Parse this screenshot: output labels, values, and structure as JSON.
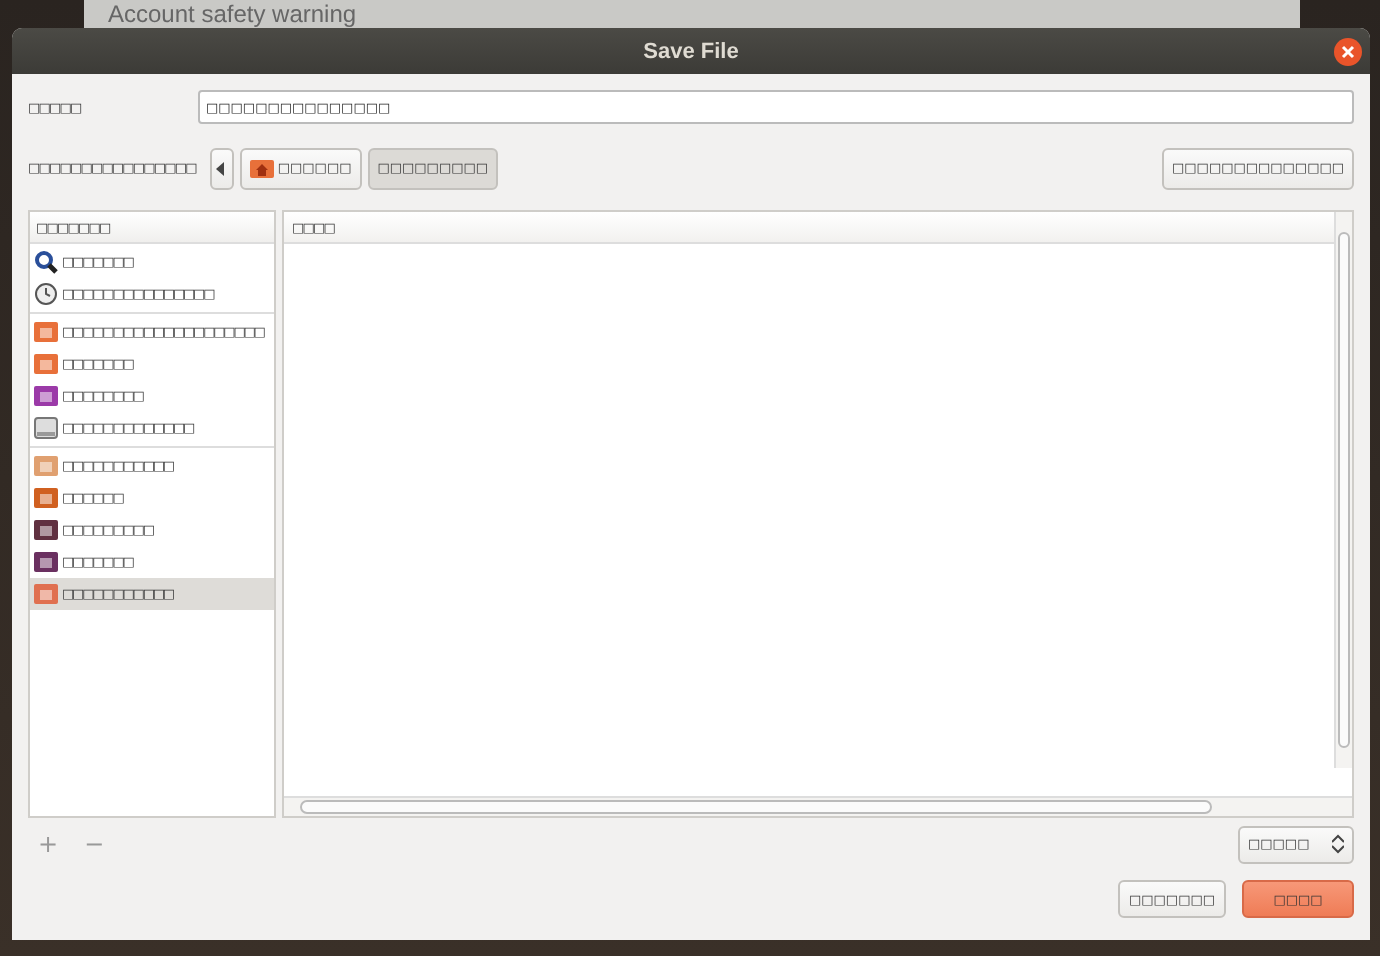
{
  "background_window": {
    "title": "Account safety warning"
  },
  "window": {
    "title": "Save File"
  },
  "name_field": {
    "label": "□□□□□",
    "value": "□□□□□□□□□□□□□□□"
  },
  "folder_row": {
    "label": "□□□□□□□□□□□□□□□□",
    "path": [
      {
        "label": "□□□□□□",
        "kind": "home",
        "selected": false
      },
      {
        "label": "□□□□□□□□□",
        "kind": "plain",
        "selected": true
      }
    ],
    "create_folder": "□□□□□□□□□□□□□□"
  },
  "sidebar": {
    "header": "□□□□□□□",
    "groups": [
      {
        "items": [
          {
            "label": "□□□□□□□",
            "kind": "search",
            "selected": false
          },
          {
            "label": "□□□□□□□□□□□□□□□",
            "kind": "recent",
            "selected": false
          }
        ]
      },
      {
        "items": [
          {
            "label": "□□□□□□□□□□□□□□□□□□□□",
            "kind": "folder",
            "selected": false
          },
          {
            "label": "□□□□□□□",
            "kind": "home",
            "selected": false
          },
          {
            "label": "□□□□□□□□",
            "kind": "desktop",
            "selected": false
          },
          {
            "label": "□□□□□□□□□□□□□",
            "kind": "drive",
            "selected": false
          }
        ]
      },
      {
        "items": [
          {
            "label": "□□□□□□□□□□□",
            "kind": "documents",
            "selected": false
          },
          {
            "label": "□□□□□□",
            "kind": "music",
            "selected": false
          },
          {
            "label": "□□□□□□□□□",
            "kind": "pictures",
            "selected": false
          },
          {
            "label": "□□□□□□□",
            "kind": "videos",
            "selected": false
          },
          {
            "label": "□□□□□□□□□□□",
            "kind": "downloads",
            "selected": true
          }
        ]
      }
    ]
  },
  "sidebar_buttons": [
    "+",
    "−"
  ],
  "file_list": {
    "columns": [
      "□□□□"
    ]
  },
  "filter": {
    "value": "□□□□□"
  },
  "buttons": [
    {
      "label": "□□□□□□□",
      "kind": "cancel"
    },
    {
      "label": "□□□□",
      "kind": "save"
    }
  ]
}
